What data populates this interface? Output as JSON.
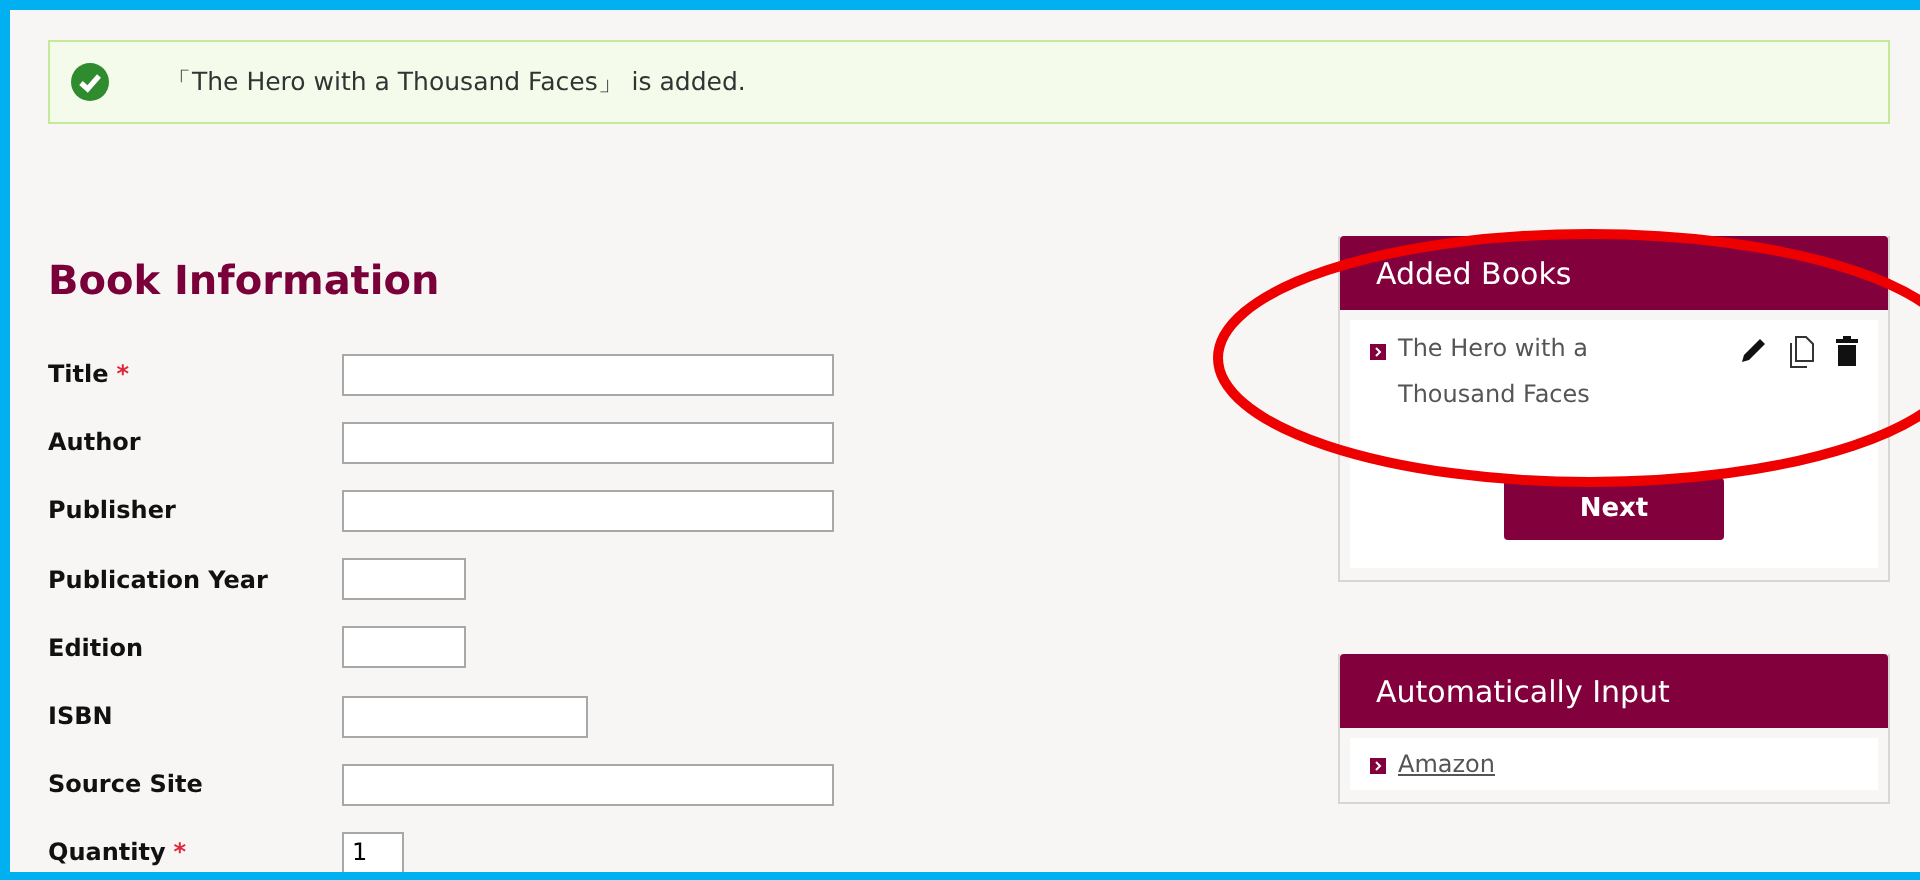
{
  "notice": {
    "text": "「The Hero with a Thousand Faces」 is added."
  },
  "form": {
    "title": "Book Information",
    "fields": [
      {
        "label": "Title",
        "required_mark": "*",
        "kind": "long"
      },
      {
        "label": "Author",
        "kind": "long"
      },
      {
        "label": "Publisher",
        "kind": "long"
      },
      {
        "label": "Publication Year",
        "kind": "short"
      },
      {
        "label": "Edition",
        "kind": "short"
      },
      {
        "label": "ISBN",
        "kind": "medium"
      },
      {
        "label": "Source Site",
        "kind": "long"
      },
      {
        "label": "Quantity",
        "required_mark": "*",
        "kind": "tiny",
        "value": "1"
      }
    ]
  },
  "added_books": {
    "title": "Added Books",
    "items": [
      "The Hero with a Thousand Faces"
    ],
    "button": "Next"
  },
  "auto_input": {
    "title": "Automatically Input",
    "links": [
      "Amazon"
    ]
  }
}
